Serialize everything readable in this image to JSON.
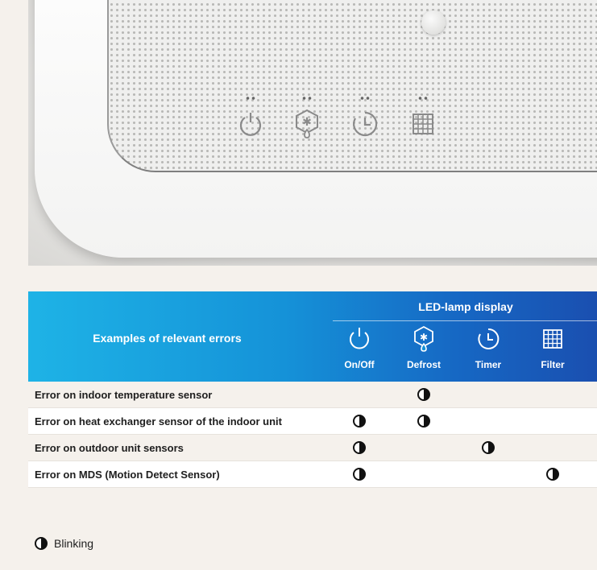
{
  "photo": {
    "alt": "Indoor unit LED lamp panel",
    "icons": [
      "power-icon",
      "defrost-icon",
      "timer-icon",
      "filter-icon"
    ]
  },
  "table": {
    "errors_header": "Examples of relevant errors",
    "lamp_header": "LED-lamp display",
    "columns": [
      {
        "label": "On/Off",
        "icon": "power-icon"
      },
      {
        "label": "Defrost",
        "icon": "defrost-icon"
      },
      {
        "label": "Timer",
        "icon": "timer-icon"
      },
      {
        "label": "Filter",
        "icon": "filter-icon"
      }
    ],
    "rows": [
      {
        "error": "Error on indoor temperature sensor",
        "blink": [
          false,
          true,
          false,
          false
        ]
      },
      {
        "error": "Error on heat exchanger sensor of the indoor unit",
        "blink": [
          true,
          true,
          false,
          false
        ]
      },
      {
        "error": "Error on outdoor unit sensors",
        "blink": [
          true,
          false,
          true,
          false
        ]
      },
      {
        "error": "Error on MDS (Motion Detect Sensor)",
        "blink": [
          true,
          false,
          false,
          true
        ]
      }
    ]
  },
  "legend": {
    "label": "Blinking",
    "icon": "half-filled-circle-icon"
  },
  "colors": {
    "header_start": "#1eb3e6",
    "header_end": "#1a4fb0",
    "background": "#f5f1ec"
  }
}
